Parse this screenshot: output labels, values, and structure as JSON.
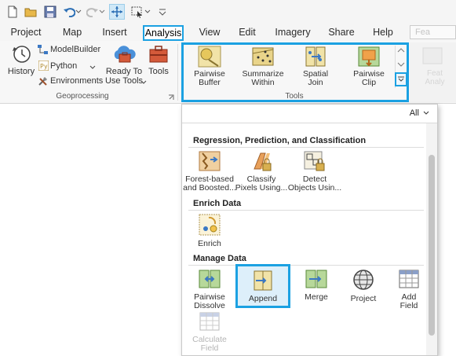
{
  "tabs": [
    "Project",
    "Map",
    "Insert",
    "Analysis",
    "View",
    "Edit",
    "Imagery",
    "Share",
    "Help"
  ],
  "search_faded": "Fea",
  "side_faded": "Feat Analy",
  "geoprocessing": {
    "history": "History",
    "modelbuilder": "ModelBuilder",
    "python": "Python",
    "environments": "Environments",
    "ready_line1": "Ready To",
    "ready_line2": "Use Tools",
    "tools": "Tools",
    "group_label": "Geoprocessing"
  },
  "tools_gallery": {
    "group_label": "Tools",
    "items": [
      {
        "line1": "Pairwise",
        "line2": "Buffer"
      },
      {
        "line1": "Summarize",
        "line2": "Within"
      },
      {
        "line1": "Spatial",
        "line2": "Join"
      },
      {
        "line1": "Pairwise",
        "line2": "Clip"
      }
    ]
  },
  "panel": {
    "filter": "All",
    "sections": [
      {
        "title": "Regression, Prediction, and Classification",
        "items": [
          {
            "line1": "Forest-based",
            "line2": "and Boosted..."
          },
          {
            "line1": "Classify",
            "line2": "Pixels Using..."
          },
          {
            "line1": "Detect",
            "line2": "Objects Usin..."
          }
        ]
      },
      {
        "title": "Enrich Data",
        "items": [
          {
            "line1": "Enrich",
            "line2": ""
          }
        ]
      },
      {
        "title": "Manage Data",
        "items": [
          {
            "line1": "Pairwise",
            "line2": "Dissolve"
          },
          {
            "line1": "Append",
            "line2": ""
          },
          {
            "line1": "Merge",
            "line2": ""
          },
          {
            "line1": "Project",
            "line2": ""
          },
          {
            "line1": "Add",
            "line2": "Field"
          },
          {
            "line1": "Calculate",
            "line2": "Field"
          }
        ]
      }
    ]
  },
  "colors": {
    "highlight": "#1ba1e2",
    "ribbon_bg": "#f7f7f7"
  }
}
